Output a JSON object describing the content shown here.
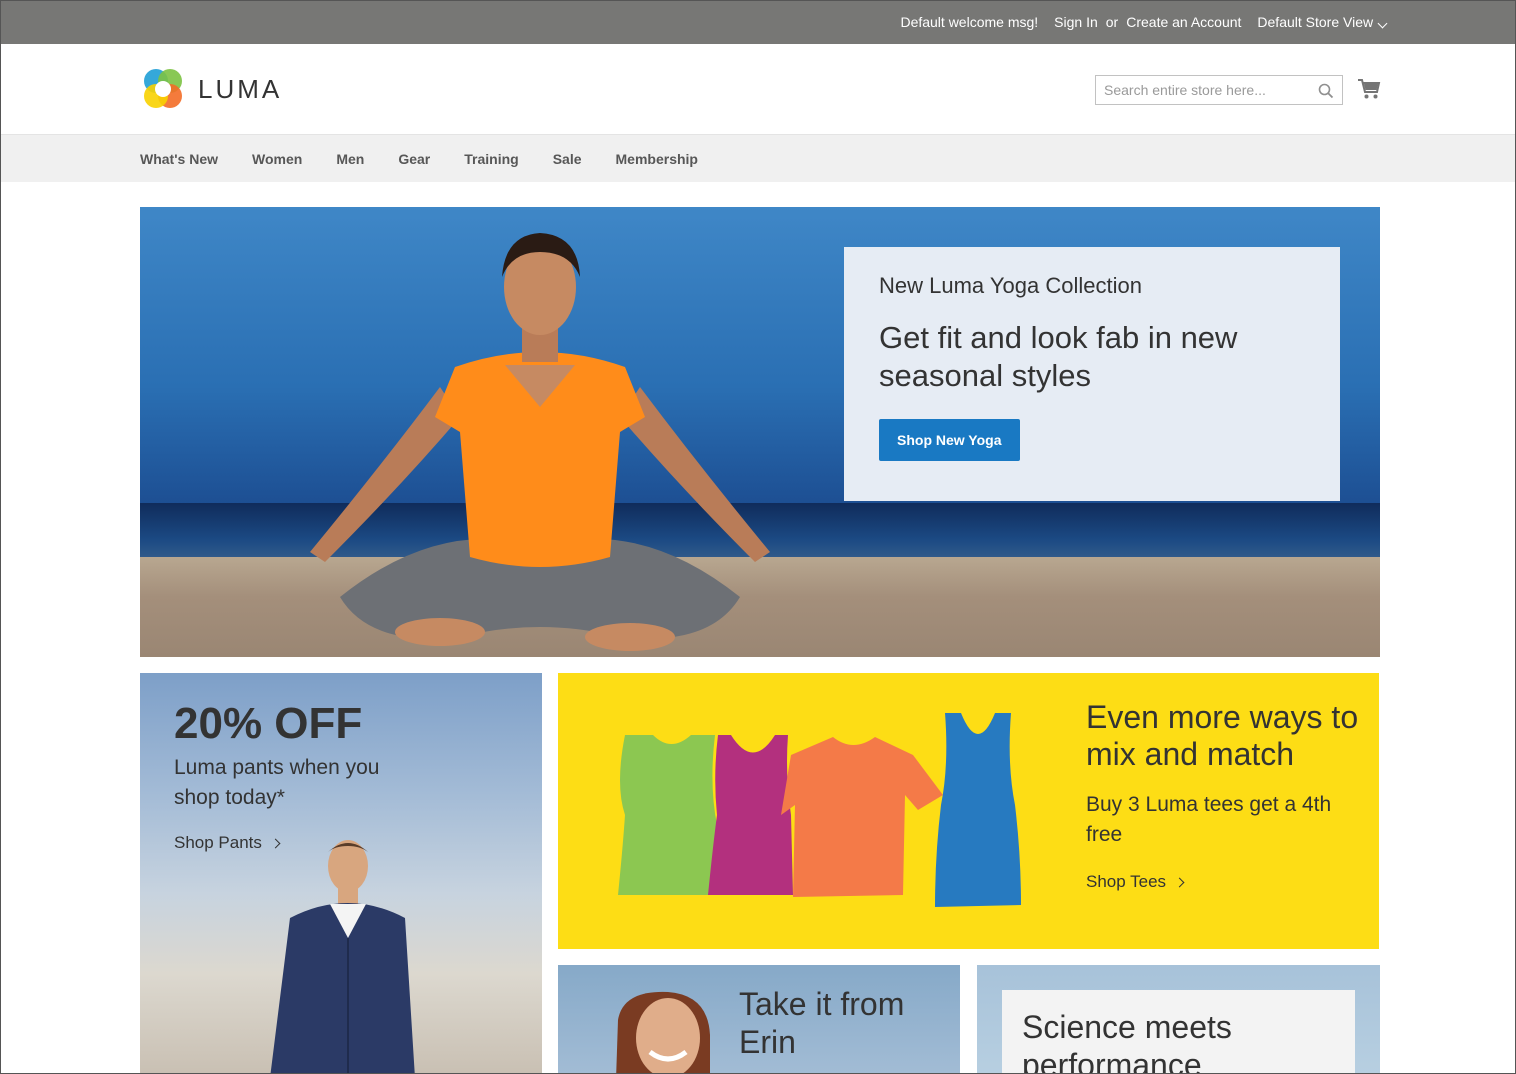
{
  "topbar": {
    "welcome": "Default welcome msg!",
    "sign_in": "Sign In",
    "or": "or",
    "create_account": "Create an Account",
    "store_view": "Default Store View"
  },
  "header": {
    "logo_text": "LUMA",
    "search_placeholder": "Search entire store here...",
    "search_value": ""
  },
  "nav": {
    "items": [
      "What's New",
      "Women",
      "Men",
      "Gear",
      "Training",
      "Sale",
      "Membership"
    ]
  },
  "hero": {
    "subtitle": "New Luma Yoga Collection",
    "headline": "Get fit and look fab in new seasonal styles",
    "button_label": "Shop New Yoga"
  },
  "pants_promo": {
    "headline": "20% OFF",
    "description": "Luma pants when you shop today*",
    "link_label": "Shop Pants"
  },
  "tees_promo": {
    "headline": "Even more ways to mix and match",
    "description": "Buy 3 Luma tees get a 4th free",
    "link_label": "Shop Tees"
  },
  "erin_promo": {
    "headline": "Take it from Erin"
  },
  "science_promo": {
    "headline": "Science meets performance"
  },
  "colors": {
    "topbar_bg": "#777775",
    "nav_bg": "#f0f0f0",
    "primary_button": "#1979c3",
    "tees_bg": "#fddd15",
    "promo_box_bg": "#e6ecf4"
  },
  "icons": {
    "search": "search-icon",
    "cart": "cart-icon",
    "store_dropdown": "chevron-down-icon",
    "link_arrow": "chevron-right-icon"
  }
}
